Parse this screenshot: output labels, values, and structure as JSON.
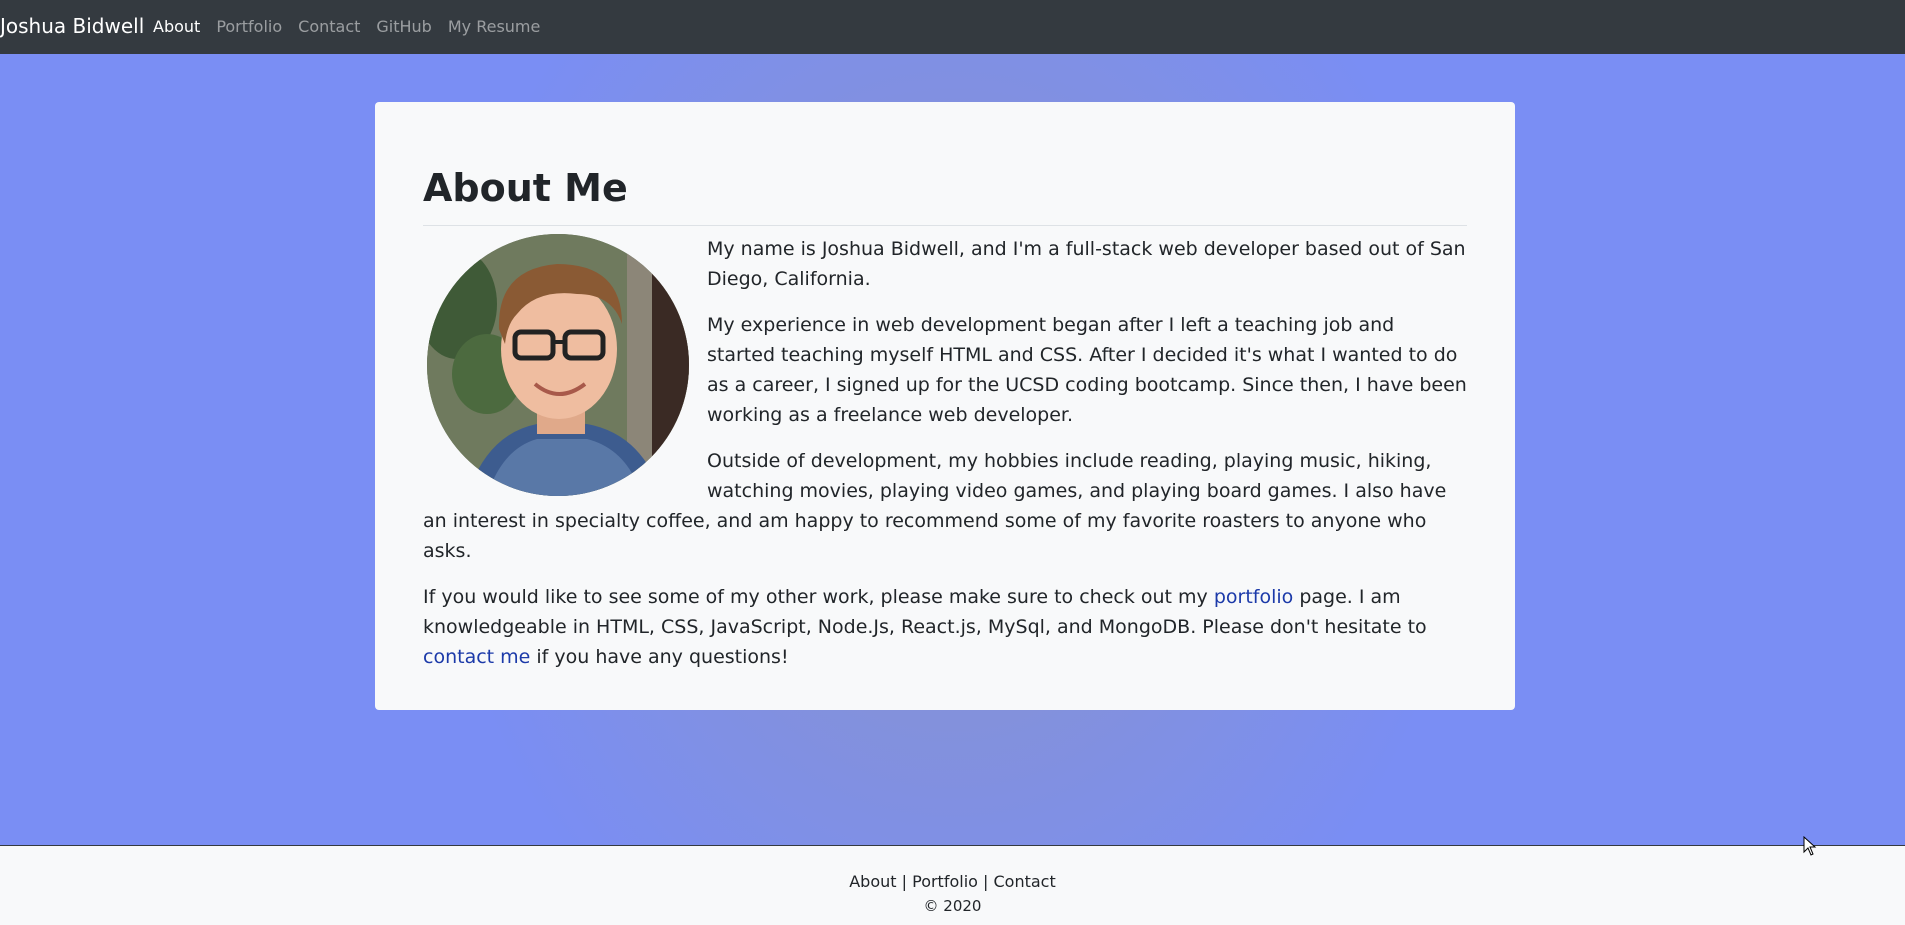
{
  "navbar": {
    "brand": "Joshua Bidwell",
    "links": [
      "About",
      "Portfolio",
      "Contact",
      "GitHub",
      "My Resume"
    ],
    "active": "About"
  },
  "main": {
    "title": "About Me",
    "avatar_alt": "portrait photo",
    "paragraph_1": "My name is Joshua Bidwell, and I'm a full-stack web developer based out of San Diego, California.",
    "paragraph_2": "My experience in web development began after I left a teaching job and started teaching myself HTML and CSS. After I decided it's what I wanted to do as a career, I signed up for the UCSD coding bootcamp. Since then, I have been working as a freelance web developer.",
    "paragraph_3": "Outside of development, my hobbies include reading, playing music, hiking, watching movies, playing video games, and playing board games. I also have an interest in specialty coffee, and am happy to recommend some of my favorite roasters to anyone who asks.",
    "paragraph_4": {
      "before_portfolio": "If you would like to see some of my other work, please make sure to check out my ",
      "portfolio_link": "portfolio",
      "middle": " page. I am knowledgeable in HTML, CSS, JavaScript, Node.Js, React.js, MySql, and MongoDB. Please don't hesitate to ",
      "contact_link": "contact me",
      "after": " if you have any questions!"
    }
  },
  "footer": {
    "links": [
      "About",
      "Portfolio",
      "Contact"
    ],
    "separator": " | ",
    "copyright": "© 2020"
  },
  "colors": {
    "navbar_bg": "#343a40",
    "page_bg": "#7a8ef4",
    "card_bg": "#f8f9fa",
    "link": "#1c3aa9"
  }
}
